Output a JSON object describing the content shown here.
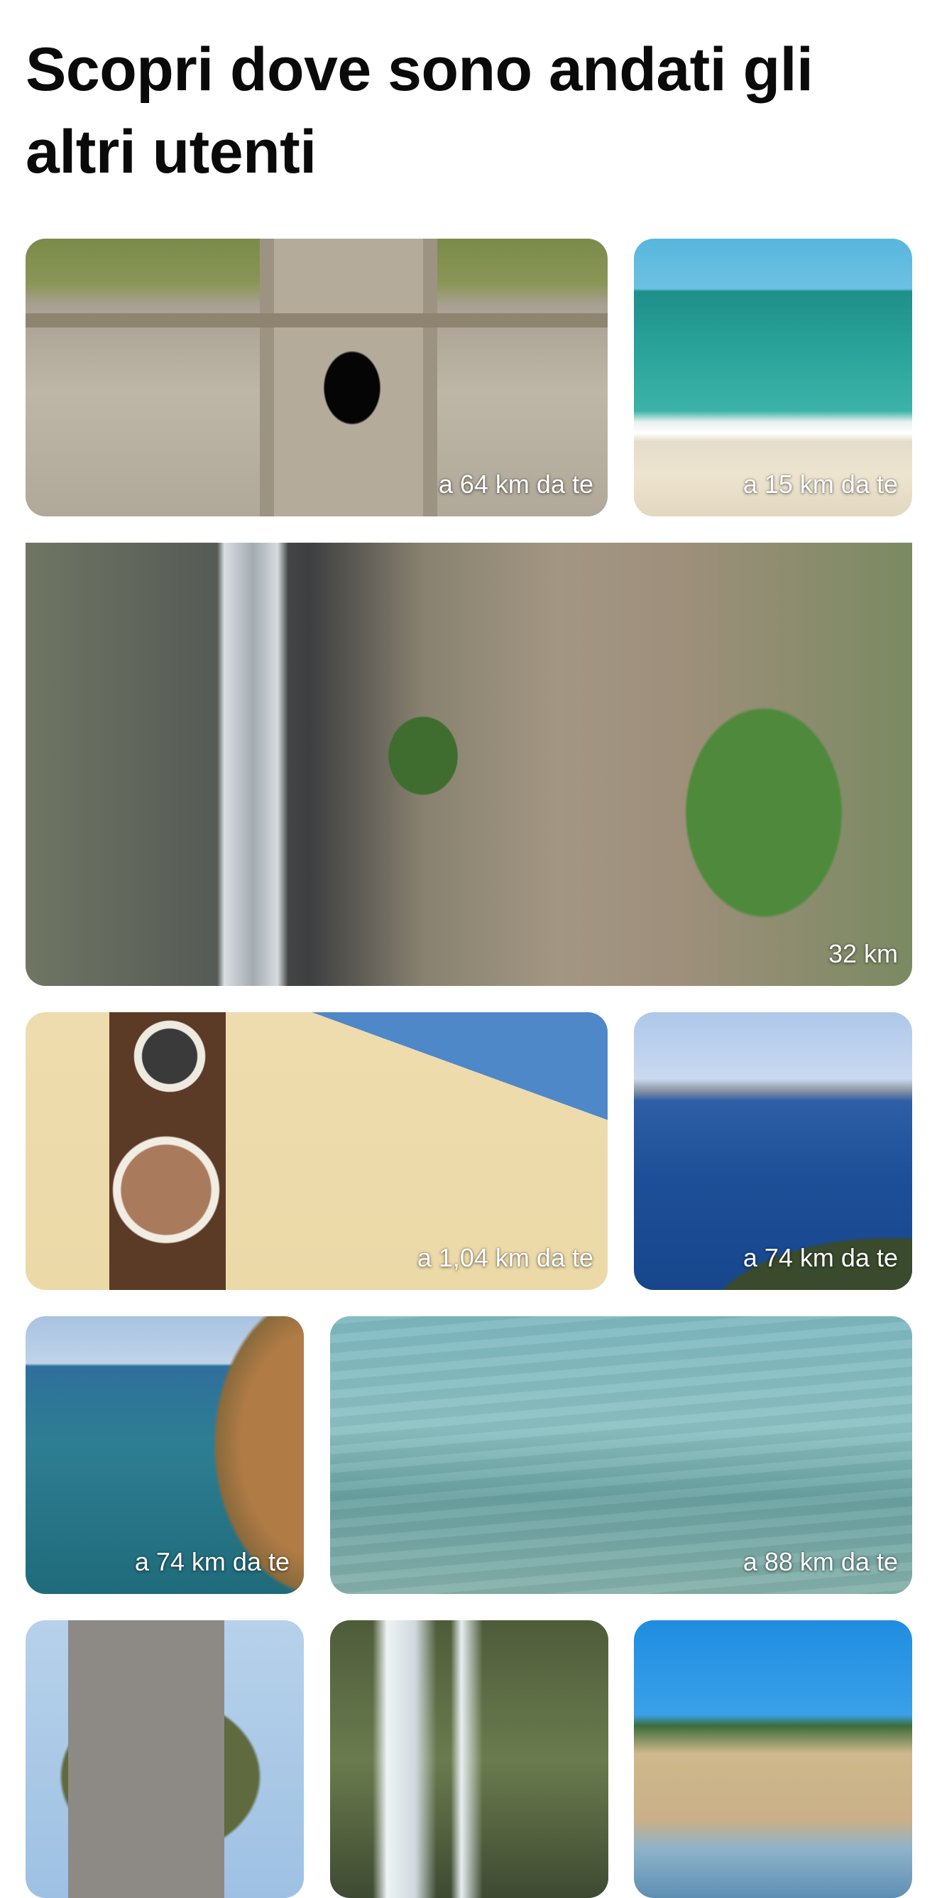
{
  "header": {
    "title": "Scopri dove sono andati gli altri utenti"
  },
  "places": [
    {
      "image": "rock-cut-tomb-photo",
      "distance": "a 64 km da te"
    },
    {
      "image": "sandy-beach-photo",
      "distance": "a 15 km da te"
    },
    {
      "image": "waterfall-cliff-photo",
      "distance": "32 km"
    },
    {
      "image": "church-facade-photo",
      "distance": "a 1,04 km da te"
    },
    {
      "image": "coastal-bay-photo",
      "distance": "a 74 km da te"
    },
    {
      "image": "rocky-cove-photo",
      "distance": "a 74 km da te"
    },
    {
      "image": "clear-shallow-sea-photo",
      "distance": "a 88 km da te"
    },
    {
      "image": "hilltop-castle-photo",
      "distance": ""
    },
    {
      "image": "forest-waterfall-photo",
      "distance": ""
    },
    {
      "image": "dune-shore-photo",
      "distance": ""
    }
  ]
}
